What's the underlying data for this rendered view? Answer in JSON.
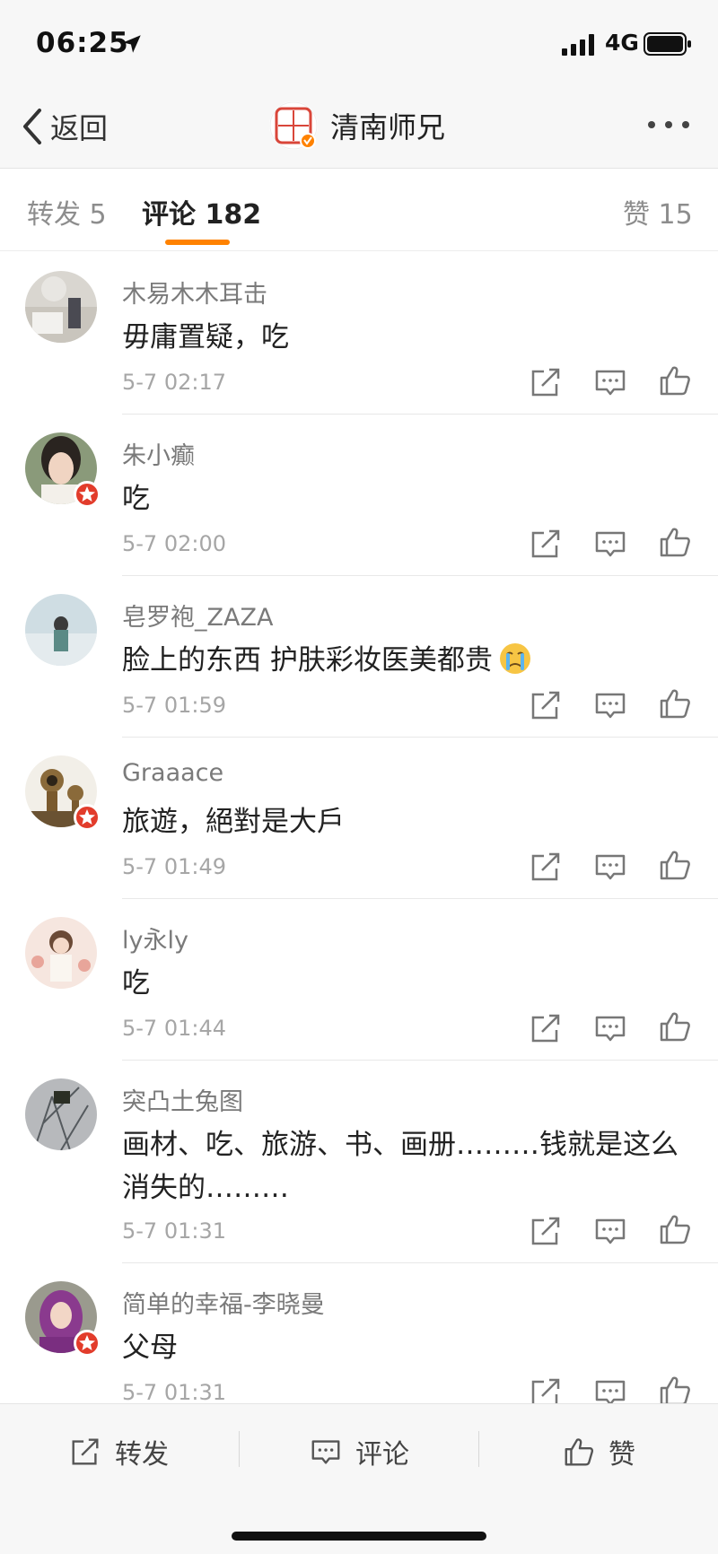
{
  "status": {
    "time": "06:25",
    "network": "4G"
  },
  "nav": {
    "back_label": "返回",
    "title": "清南师兄",
    "avatar_text": "師清兄南"
  },
  "tabs": {
    "repost": "转发 5",
    "comments": "评论 182",
    "likes": "赞 15"
  },
  "comments": [
    {
      "name": "木易木木耳击",
      "text": "毋庸置疑，吃",
      "time": "5-7 02:17",
      "verified": false
    },
    {
      "name": "朱小癫",
      "text": "吃",
      "time": "5-7 02:00",
      "verified": true
    },
    {
      "name": "皂罗袍_ZAZA",
      "text": "脸上的东西 护肤彩妆医美都贵",
      "time": "5-7 01:59",
      "verified": false
    },
    {
      "name": "Graaace",
      "text": "旅遊，絕對是大戶",
      "time": "5-7 01:49",
      "verified": true
    },
    {
      "name": "ly永ly",
      "text": "吃",
      "time": "5-7 01:44",
      "verified": false
    },
    {
      "name": "突凸土兔图",
      "text": "画材、吃、旅游、书、画册………钱就是这么消失的………",
      "time": "5-7 01:31",
      "verified": false
    },
    {
      "name": "简单的幸福-李晓曼",
      "text": "父母",
      "time": "5-7 01:31",
      "verified": true
    }
  ],
  "bottom": {
    "repost": "转发",
    "comment": "评论",
    "like": "赞"
  },
  "colors": {
    "accent": "#ff8200",
    "verified": "#e23c2b"
  }
}
